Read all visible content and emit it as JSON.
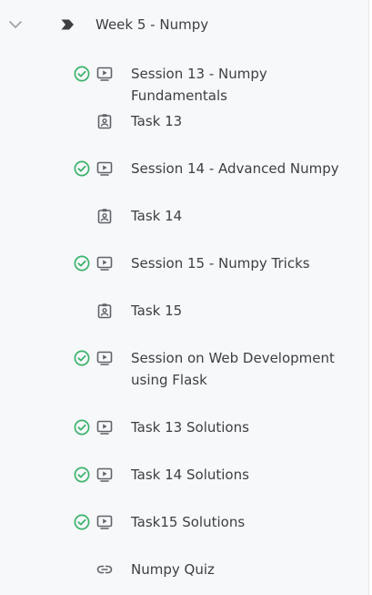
{
  "week": {
    "title": "Week 5 - Numpy",
    "expanded": true,
    "chevron_icon": "chevron-down-icon",
    "tag_icon": "tag-icon"
  },
  "colors": {
    "complete": "#3bb36b",
    "icon": "#5f6368",
    "text": "#3c4043",
    "panel_bg": "#f7f8fa"
  },
  "items": [
    {
      "label": "Session 13 - Numpy Fundamentals",
      "type": "video",
      "completed": true
    },
    {
      "label": "Task 13",
      "type": "assignment",
      "completed": false
    },
    {
      "label": "Session 14 - Advanced Numpy",
      "type": "video",
      "completed": true
    },
    {
      "label": "Task 14",
      "type": "assignment",
      "completed": false
    },
    {
      "label": "Session 15 - Numpy Tricks",
      "type": "video",
      "completed": true
    },
    {
      "label": "Task 15",
      "type": "assignment",
      "completed": false
    },
    {
      "label": "Session on Web Development using Flask",
      "type": "video",
      "completed": true
    },
    {
      "label": "Task 13 Solutions",
      "type": "video",
      "completed": true
    },
    {
      "label": "Task 14 Solutions",
      "type": "video",
      "completed": true
    },
    {
      "label": "Task15 Solutions",
      "type": "video",
      "completed": true
    },
    {
      "label": "Numpy Quiz",
      "type": "link",
      "completed": false
    }
  ]
}
